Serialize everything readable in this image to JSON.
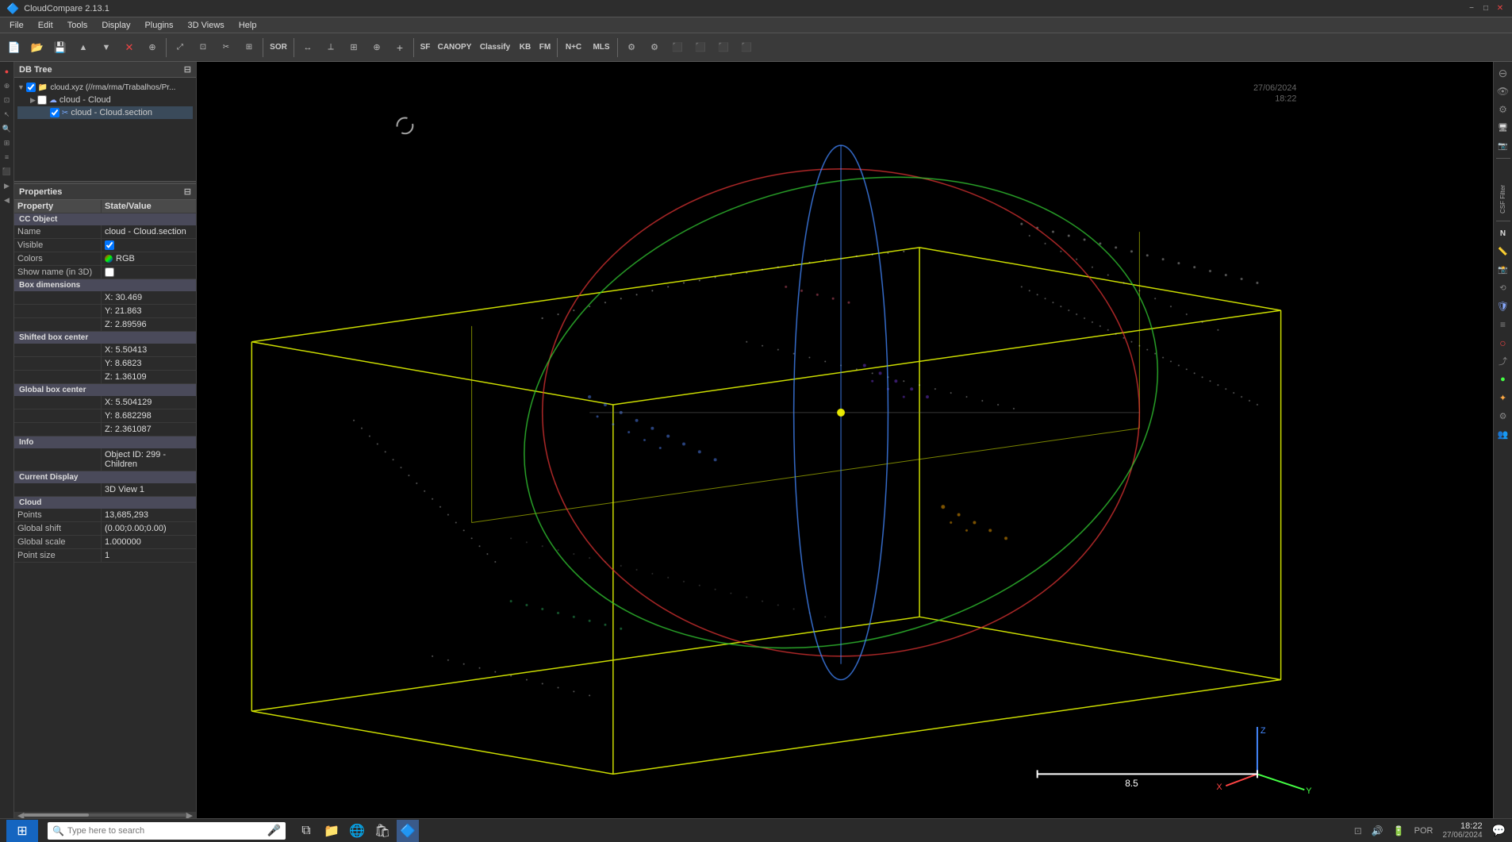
{
  "app": {
    "title": "CloudCompare 2.13.1",
    "version": "2.13.1"
  },
  "titlebar": {
    "title": "CloudCompare",
    "minimize": "−",
    "maximize": "□",
    "close": "✕"
  },
  "menu": {
    "items": [
      "File",
      "Edit",
      "Tools",
      "Display",
      "Plugins",
      "3D Views",
      "Help"
    ]
  },
  "toolbar": {
    "buttons": [
      {
        "name": "new",
        "icon": "📄"
      },
      {
        "name": "open",
        "icon": "📂"
      },
      {
        "name": "save",
        "icon": "💾"
      },
      {
        "name": "import",
        "icon": "⬆"
      },
      {
        "name": "export",
        "icon": "⬇"
      },
      {
        "name": "delete",
        "icon": "✕"
      },
      {
        "name": "sample",
        "icon": "⚙"
      },
      {
        "sep": true
      },
      {
        "name": "select",
        "icon": "↖"
      },
      {
        "name": "transform",
        "icon": "⤢"
      },
      {
        "name": "segment",
        "icon": "✂"
      },
      {
        "sep": true
      },
      {
        "name": "sor",
        "label": "SOR"
      },
      {
        "sep": true
      },
      {
        "name": "distance",
        "icon": "↔"
      },
      {
        "name": "normals",
        "icon": "⟂"
      },
      {
        "name": "octree",
        "icon": "⊞"
      },
      {
        "name": "merge",
        "icon": "⊕"
      },
      {
        "name": "plus",
        "icon": "+"
      },
      {
        "sep": true
      },
      {
        "name": "sf",
        "label": "SF"
      },
      {
        "name": "canopy",
        "label": "CANOPY"
      },
      {
        "name": "classify",
        "label": "Classify"
      },
      {
        "name": "kb",
        "label": "KB"
      },
      {
        "name": "fm",
        "label": "FM"
      },
      {
        "sep": true
      },
      {
        "name": "nplus",
        "label": "N+C"
      },
      {
        "name": "mls",
        "label": "MLS"
      },
      {
        "sep": true
      },
      {
        "name": "plugin1",
        "icon": "⚙"
      },
      {
        "name": "plugin2",
        "icon": "⚙"
      }
    ]
  },
  "dbtree": {
    "title": "DB Tree",
    "items": [
      {
        "id": 1,
        "level": 1,
        "label": "cloud.xyz (//rma/rma/Trabalhos/Pr...",
        "type": "cloud",
        "visible": true,
        "checked": true
      },
      {
        "id": 2,
        "level": 2,
        "label": "cloud - Cloud",
        "type": "cloud",
        "visible": true,
        "checked": false
      },
      {
        "id": 3,
        "level": 3,
        "label": "cloud - Cloud.section",
        "type": "section",
        "visible": true,
        "checked": true
      }
    ]
  },
  "properties": {
    "title": "Properties",
    "sections": [
      {
        "name": "CC Object",
        "rows": [
          {
            "key": "Name",
            "value": "cloud - Cloud.section",
            "type": "text"
          },
          {
            "key": "Visible",
            "value": "",
            "type": "checkbox",
            "checked": true
          },
          {
            "key": "Colors",
            "value": "RGB",
            "type": "rgb"
          },
          {
            "key": "Show name (in 3D)",
            "value": "",
            "type": "checkbox",
            "checked": false
          }
        ]
      },
      {
        "name": "Box dimensions",
        "rows": [
          {
            "key": "",
            "value": "X: 30.469",
            "type": "text"
          },
          {
            "key": "",
            "value": "Y: 21.863",
            "type": "text"
          },
          {
            "key": "",
            "value": "Z: 2.89596",
            "type": "text"
          }
        ]
      },
      {
        "name": "Shifted box center",
        "rows": [
          {
            "key": "",
            "value": "X: 5.50413",
            "type": "text"
          },
          {
            "key": "",
            "value": "Y: 8.6823",
            "type": "text"
          },
          {
            "key": "",
            "value": "Z: 1.36109",
            "type": "text"
          }
        ]
      },
      {
        "name": "Global box center",
        "rows": [
          {
            "key": "",
            "value": "X: 5.504129",
            "type": "text"
          },
          {
            "key": "",
            "value": "Y: 8.682298",
            "type": "text"
          },
          {
            "key": "",
            "value": "Z: 2.361087",
            "type": "text"
          }
        ]
      },
      {
        "name": "Info",
        "rows": [
          {
            "key": "",
            "value": "Object ID: 299 - Children",
            "type": "text"
          }
        ]
      },
      {
        "name": "Current Display",
        "rows": [
          {
            "key": "",
            "value": "3D View 1",
            "type": "text"
          }
        ]
      },
      {
        "name": "Cloud",
        "rows": [
          {
            "key": "Points",
            "value": "13,685,293",
            "type": "text"
          },
          {
            "key": "Global shift",
            "value": "(0.00;0.00;0.00)",
            "type": "text"
          },
          {
            "key": "Global scale",
            "value": "1.000000",
            "type": "text"
          },
          {
            "key": "Point size",
            "value": "1",
            "type": "text"
          }
        ]
      }
    ]
  },
  "right_sidebar": {
    "items": [
      {
        "name": "segment",
        "icon": "⊖"
      },
      {
        "name": "view",
        "icon": "👁"
      },
      {
        "name": "settings",
        "icon": "⚙"
      },
      {
        "name": "info",
        "icon": "ℹ"
      },
      {
        "name": "csf",
        "label": "CSF Filter"
      },
      {
        "name": "north",
        "icon": "N"
      },
      {
        "name": "measure",
        "icon": "📏"
      },
      {
        "name": "camera",
        "icon": "📷"
      },
      {
        "name": "transform2",
        "icon": "⟲"
      },
      {
        "name": "layers",
        "icon": "≡"
      },
      {
        "name": "circle",
        "icon": "○"
      },
      {
        "name": "export2",
        "icon": "⤴"
      },
      {
        "name": "cloud2",
        "icon": "☁"
      },
      {
        "name": "group",
        "icon": "👥"
      }
    ]
  },
  "viewport": {
    "date": "27/06/2024",
    "time": "18:22",
    "scale_value": "8.5",
    "axes": {
      "x_label": "X",
      "y_label": "Y",
      "z_label": "Z"
    }
  },
  "statusbar": {
    "search_placeholder": "Type here to search",
    "time": "18:22",
    "date": "27/06/2024",
    "language": "POR",
    "battery": "🔋",
    "wifi": "📶",
    "volume": "🔊"
  }
}
